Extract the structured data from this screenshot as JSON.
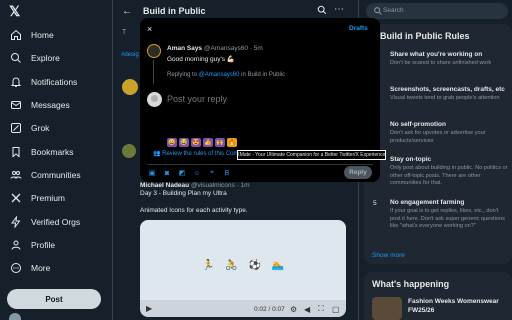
{
  "sidebar": {
    "logo": "𝕏",
    "items": [
      {
        "label": "Home",
        "icon": "home-icon"
      },
      {
        "label": "Explore",
        "icon": "search-icon"
      },
      {
        "label": "Notifications",
        "icon": "bell-icon"
      },
      {
        "label": "Messages",
        "icon": "mail-icon"
      },
      {
        "label": "Grok",
        "icon": "grok-icon"
      },
      {
        "label": "Bookmarks",
        "icon": "bookmark-icon"
      },
      {
        "label": "Communities",
        "icon": "people-icon"
      },
      {
        "label": "Premium",
        "icon": "x-icon"
      },
      {
        "label": "Verified Orgs",
        "icon": "lightning-icon"
      },
      {
        "label": "Profile",
        "icon": "person-icon"
      },
      {
        "label": "More",
        "icon": "more-icon"
      }
    ],
    "post_label": "Post"
  },
  "main": {
    "title": "Build in Public",
    "tab_fragment": "T",
    "hashtag_fragment": "#desig",
    "feed": {
      "author": "Michael Nadeau",
      "handle": "@visualmicons · 1m",
      "line1": "Day 3 - Building Plan my Ultra",
      "line2": "Animated Icons for each activity type.",
      "video_icons": "🏃 🚴 ⚽ 🏊",
      "video_time": "0:02 / 0:07"
    }
  },
  "modal": {
    "close_label": "×",
    "drafts_label": "Drafts",
    "author_name": "Aman Says",
    "author_handle": "@Amansays60 · 5m",
    "post_text": "Good morning guy's 💪🏻",
    "replying_prefix": "Replying to",
    "replying_handle": "@Amansays60",
    "replying_suffix": "in Build in Public",
    "input_placeholder": "Post your reply",
    "reactions": [
      "😀",
      "😂",
      "😍",
      "👍",
      "🙌",
      "🔥"
    ],
    "review_text": "Review the rules of this Com",
    "reply_label": "Reply",
    "tooltip": "XMate - Your Ultimate Companion for a Better Twitter/X Experience!"
  },
  "right": {
    "search_placeholder": "Search",
    "rules_title": "Build in Public Rules",
    "rules": [
      {
        "num": "",
        "heading": "Share what you're working on",
        "desc": "Don't be scared to share unfinished work"
      },
      {
        "num": "",
        "heading": "Screenshots, screencasts, drafts, etc",
        "desc": "Visual tweets tend to grab people's attention"
      },
      {
        "num": "",
        "heading": "No self-promotion",
        "desc": "Don't ask for upvotes or advertise your products/services"
      },
      {
        "num": "",
        "heading": "Stay on-topic",
        "desc": "Only post about building in public. No politics or other off-topic posts. There are other communities for that."
      },
      {
        "num": "5",
        "heading": "No engagement farming",
        "desc": "If your goal is to get replies, likes, etc., don't post it here. Don't ask super generic questions like \"what's everyone working on?\""
      }
    ],
    "show_more": "Show more",
    "happening_title": "What's happening",
    "trend_line1": "Fashion Weeks Womenswear",
    "trend_line2": "FW25/26"
  }
}
